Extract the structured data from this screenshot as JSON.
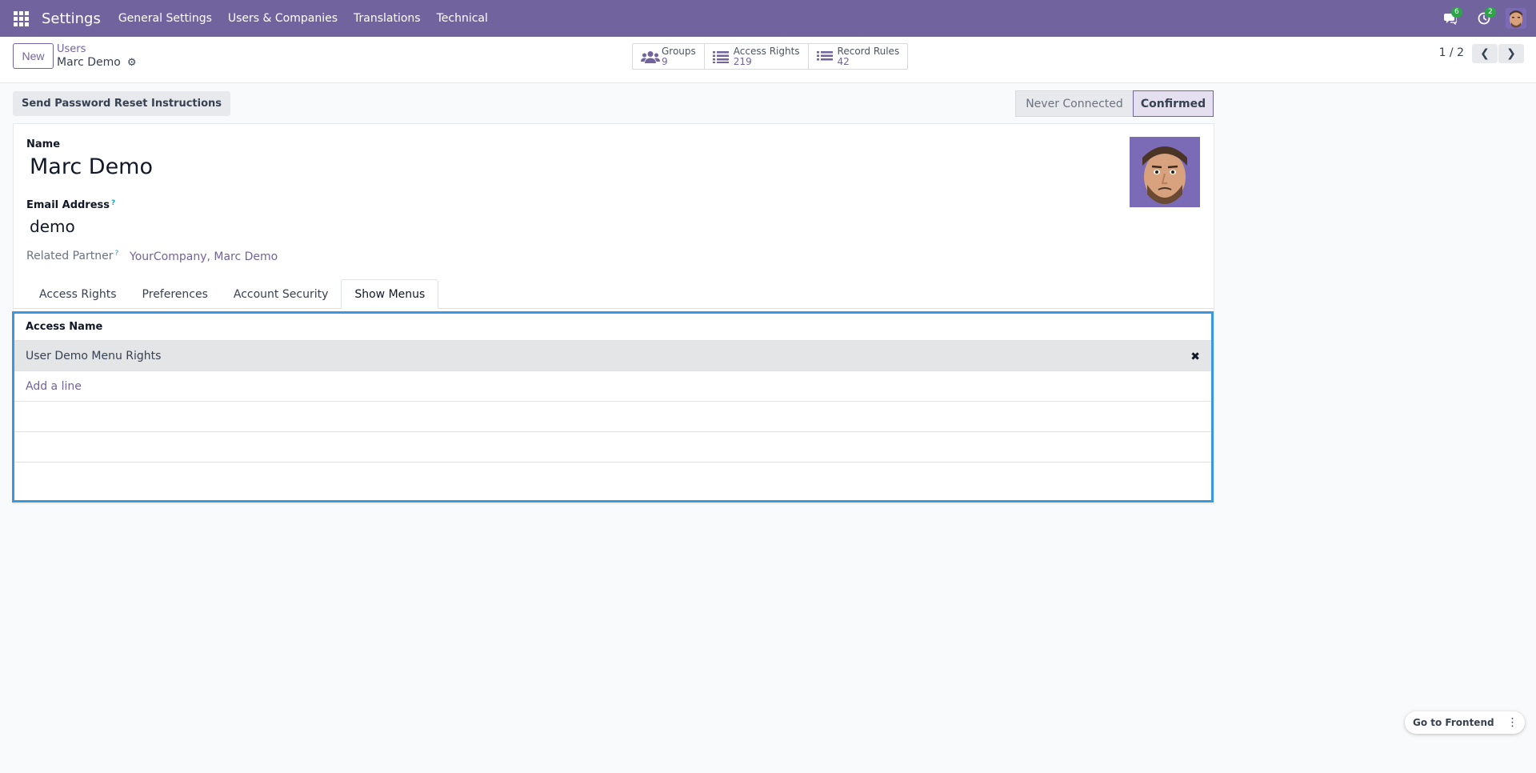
{
  "navbar": {
    "apps_icon": "apps-grid-icon",
    "brand": "Settings",
    "menu": [
      "General Settings",
      "Users & Companies",
      "Translations",
      "Technical"
    ],
    "messages_count": "6",
    "activities_count": "2"
  },
  "control_panel": {
    "new_label": "New",
    "breadcrumb_parent": "Users",
    "breadcrumb_current": "Marc Demo",
    "smart_buttons": [
      {
        "label": "Groups",
        "value": "9",
        "icon": "users-icon"
      },
      {
        "label": "Access Rights",
        "value": "219",
        "icon": "list-icon"
      },
      {
        "label": "Record Rules",
        "value": "42",
        "icon": "list-icon"
      }
    ],
    "pager": "1 / 2"
  },
  "statusbar": {
    "reset_button": "Send Password Reset Instructions",
    "states": [
      "Never Connected",
      "Confirmed"
    ],
    "current": "Confirmed"
  },
  "form": {
    "name_label": "Name",
    "name_value": "Marc Demo",
    "email_label": "Email Address",
    "email_value": "demo",
    "related_partner_label": "Related Partner",
    "related_partner_value": "YourCompany, Marc Demo",
    "tabs": [
      "Access Rights",
      "Preferences",
      "Account Security",
      "Show Menus"
    ],
    "active_tab": "Show Menus"
  },
  "list": {
    "header": "Access Name",
    "rows": [
      "User Demo Menu Rights"
    ],
    "add_line": "Add a line"
  },
  "floating": {
    "frontend_label": "Go to Frontend"
  },
  "colors": {
    "brand": "#71639e",
    "selection_border": "#3a97e0",
    "badge": "#28a745"
  }
}
